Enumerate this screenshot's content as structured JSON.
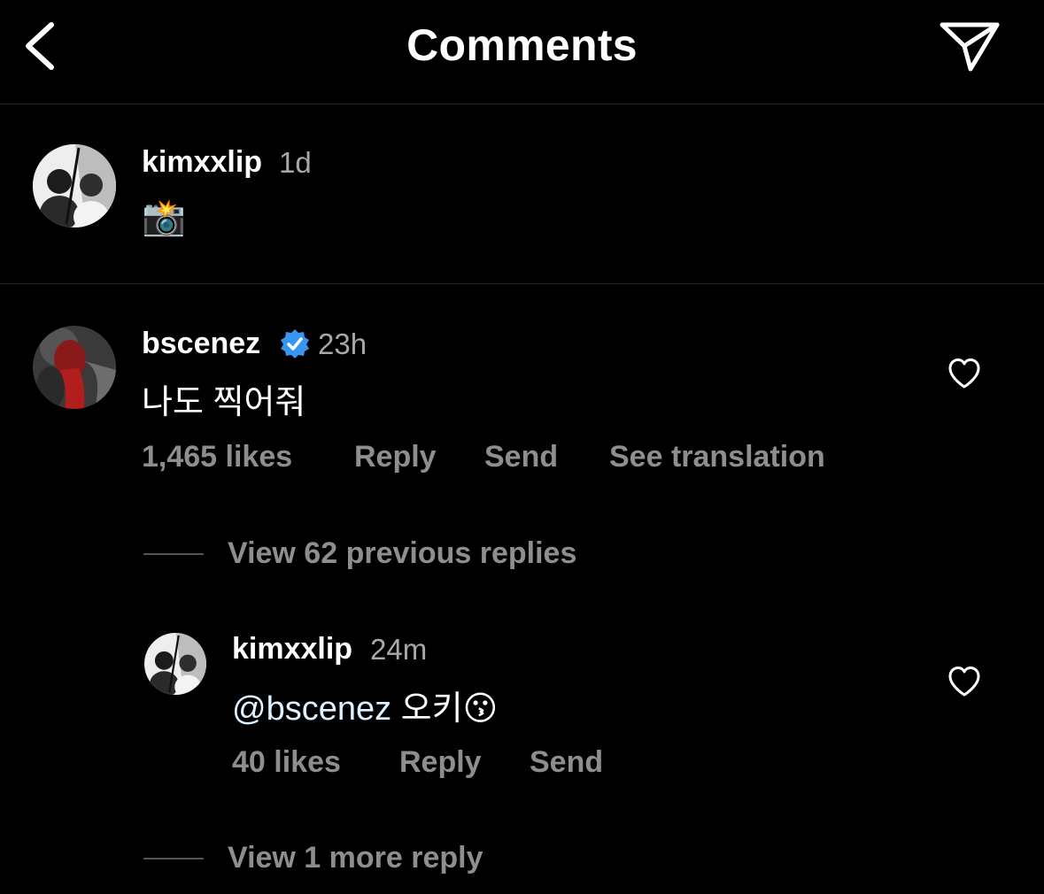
{
  "header": {
    "title": "Comments"
  },
  "caption": {
    "username": "kimxxlip",
    "time": "1d",
    "text": "📸"
  },
  "comment": {
    "username": "bscenez",
    "time": "23h",
    "text": "나도 찍어줘",
    "likes": "1,465 likes",
    "reply_label": "Reply",
    "send_label": "Send",
    "translate_label": "See translation",
    "view_replies": "View 62 previous replies"
  },
  "reply": {
    "username": "kimxxlip",
    "time": "24m",
    "mention": "@bscenez",
    "text": " 오키😗",
    "likes": "40 likes",
    "reply_label": "Reply",
    "send_label": "Send",
    "view_more": "View 1 more reply"
  },
  "icons": {
    "back": "chevron-left-icon",
    "share": "paper-plane-icon",
    "like": "heart-outline-icon",
    "verified": "verified-badge-icon"
  },
  "colors": {
    "background": "#000000",
    "text_primary": "#ffffff",
    "text_secondary": "#a8a8a8",
    "action": "#8e8e8e",
    "verified": "#3797f0",
    "divider": "#262626"
  }
}
